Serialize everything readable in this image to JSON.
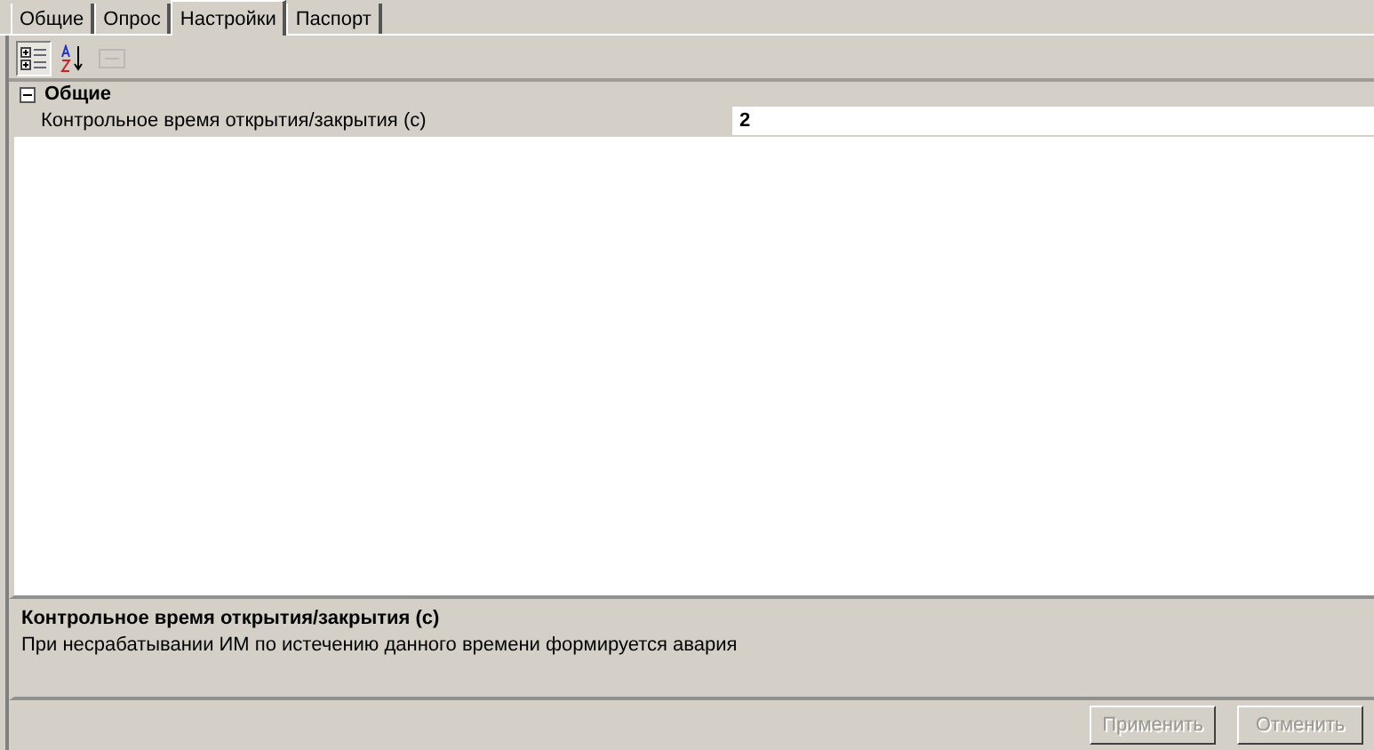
{
  "tabs": [
    {
      "label": "Общие",
      "selected": false
    },
    {
      "label": "Опрос",
      "selected": false
    },
    {
      "label": "Настройки",
      "selected": true
    },
    {
      "label": "Паспорт",
      "selected": false
    }
  ],
  "toolbar": [
    {
      "kind": "categorized",
      "selected": true,
      "disabled": false
    },
    {
      "kind": "alphabetical",
      "selected": false,
      "disabled": false
    },
    {
      "kind": "pages",
      "selected": false,
      "disabled": true
    }
  ],
  "grid": {
    "categories": [
      {
        "name": "Общие",
        "expanded": true,
        "properties": [
          {
            "name": "Контрольное время открытия/закрытия (c)",
            "value": "2",
            "selected": true
          }
        ]
      }
    ]
  },
  "description": {
    "title": "Контрольное время открытия/закрытия (c)",
    "text": "При несрабатывании ИМ по истечению данного времени формируется авария"
  },
  "buttons": [
    {
      "label": "Применить",
      "disabled": true
    },
    {
      "label": "Отменить",
      "disabled": true
    }
  ]
}
